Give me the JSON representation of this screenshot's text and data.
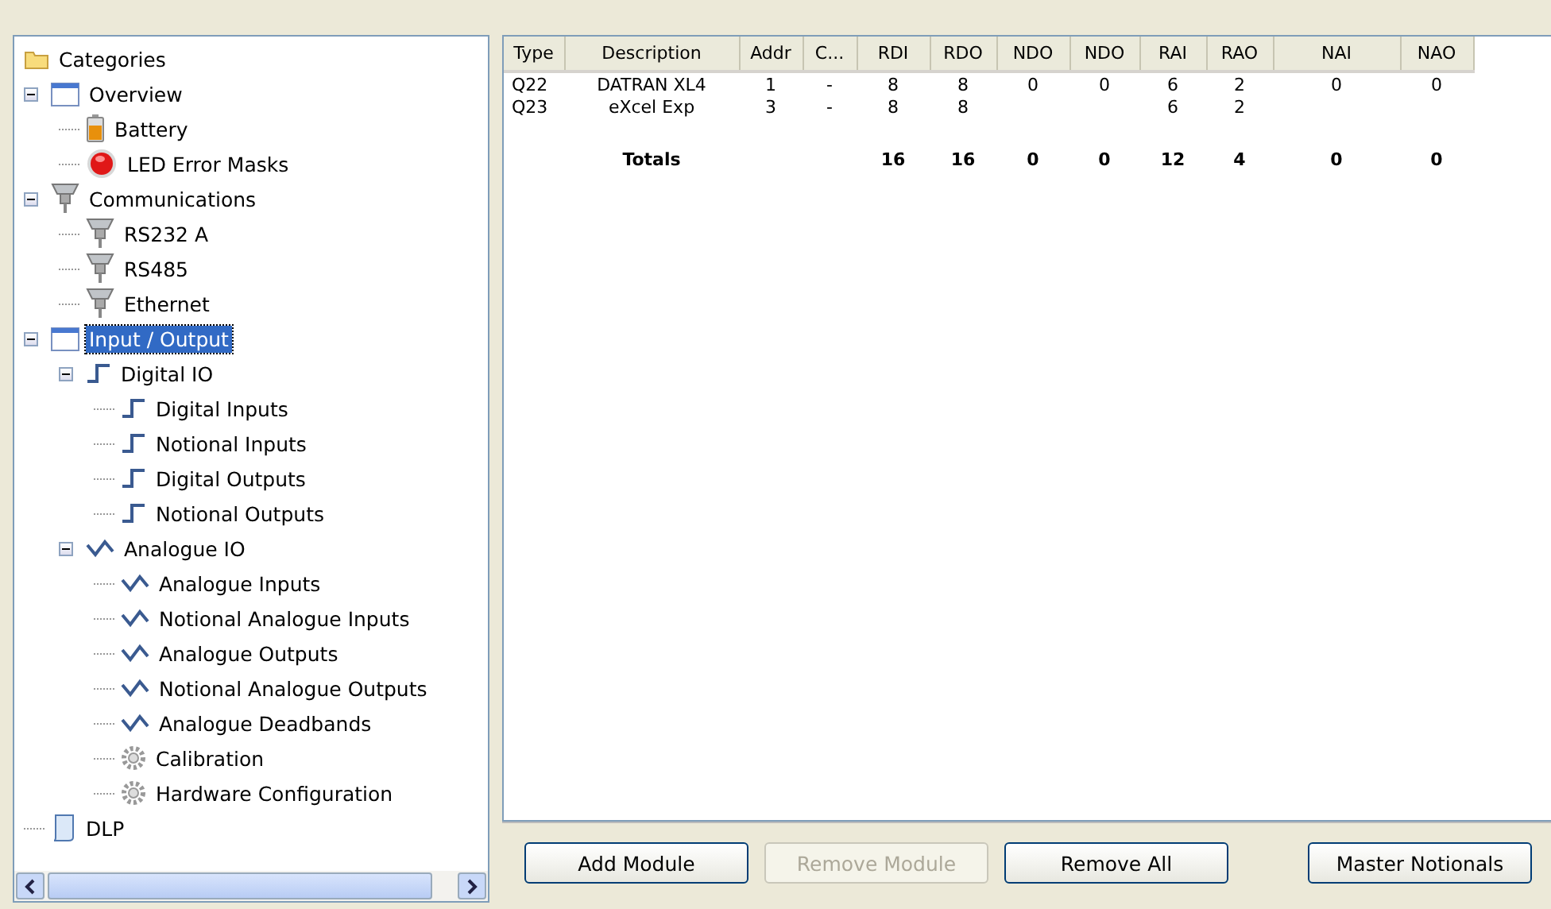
{
  "tree": {
    "root": {
      "label": "Categories",
      "kind": "folder"
    },
    "items": [
      {
        "label": "Overview",
        "kind": "window",
        "expanded": true,
        "selected": false,
        "children": [
          {
            "label": "Battery",
            "kind": "battery",
            "selected": false
          },
          {
            "label": "LED Error Masks",
            "kind": "led",
            "selected": false
          }
        ]
      },
      {
        "label": "Communications",
        "kind": "connector",
        "expanded": true,
        "selected": false,
        "children": [
          {
            "label": "RS232 A",
            "kind": "connector",
            "selected": false
          },
          {
            "label": "RS485",
            "kind": "connector",
            "selected": false
          },
          {
            "label": "Ethernet",
            "kind": "connector",
            "selected": false
          }
        ]
      },
      {
        "label": "Input / Output",
        "kind": "window",
        "expanded": true,
        "selected": true,
        "children": [
          {
            "label": "Digital IO",
            "kind": "step",
            "expanded": true,
            "selected": false,
            "children": [
              {
                "label": "Digital Inputs",
                "kind": "step",
                "selected": false
              },
              {
                "label": "Notional Inputs",
                "kind": "step",
                "selected": false
              },
              {
                "label": "Digital Outputs",
                "kind": "step",
                "selected": false
              },
              {
                "label": "Notional Outputs",
                "kind": "step",
                "selected": false
              }
            ]
          },
          {
            "label": "Analogue IO",
            "kind": "wave",
            "expanded": true,
            "selected": false,
            "children": [
              {
                "label": "Analogue Inputs",
                "kind": "wave",
                "selected": false
              },
              {
                "label": "Notional Analogue Inputs",
                "kind": "wave",
                "selected": false
              },
              {
                "label": "Analogue Outputs",
                "kind": "wave",
                "selected": false
              },
              {
                "label": "Notional Analogue Outputs",
                "kind": "wave",
                "selected": false
              },
              {
                "label": "Analogue Deadbands",
                "kind": "wave",
                "selected": false
              },
              {
                "label": "Calibration",
                "kind": "gear",
                "selected": false
              },
              {
                "label": "Hardware Configuration",
                "kind": "gear",
                "selected": false
              }
            ]
          }
        ]
      },
      {
        "label": "DLP",
        "kind": "scroll",
        "selected": false
      }
    ]
  },
  "table": {
    "columns": [
      "Type",
      "Description",
      "Addr",
      "C...",
      "RDI",
      "RDO",
      "NDO",
      "NDO",
      "RAI",
      "RAO",
      "NAI",
      "NAO"
    ],
    "rows": [
      {
        "type": "Q22",
        "description": "DATRAN XL4",
        "addr": "1",
        "c": "-",
        "rdi": "8",
        "rdo": "8",
        "ndo_1": "0",
        "ndo_2": "0",
        "rai": "6",
        "rao": "2",
        "nai": "0",
        "nao": "0"
      },
      {
        "type": "Q23",
        "description": "eXcel Exp",
        "addr": "3",
        "c": "-",
        "rdi": "8",
        "rdo": "8",
        "rai": "6",
        "rao": "2"
      }
    ],
    "totals": {
      "description": "Totals",
      "rdi": "16",
      "rdo": "16",
      "ndo_1": "0",
      "ndo_2": "0",
      "rai": "12",
      "rao": "4",
      "nai": "0",
      "nao": "0"
    }
  },
  "buttons": [
    {
      "label": "Add Module",
      "disabled": false
    },
    {
      "label": "Remove Module",
      "disabled": true
    },
    {
      "label": "Remove All",
      "disabled": false
    },
    {
      "label": "Master Notionals",
      "disabled": false
    }
  ]
}
